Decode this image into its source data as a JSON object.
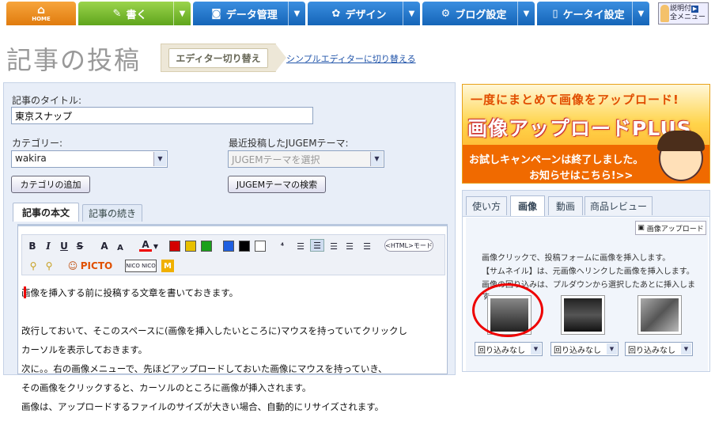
{
  "nav": {
    "home": "HOME",
    "write": "書く",
    "data": "データ管理",
    "design": "デザイン",
    "blog": "ブログ設定",
    "mobile": "ケータイ設定",
    "help_line1": "説明付",
    "help_line2": "全メニュー"
  },
  "page": {
    "title": "記事の投稿",
    "editor_switch": "エディター切り替え",
    "simple_editor_link": "シンプルエディターに切り替える"
  },
  "form": {
    "title_label": "記事のタイトル:",
    "title_value": "東京スナップ",
    "category_label": "カテゴリー:",
    "category_value": "wakira",
    "jugem_label": "最近投稿したJUGEMテーマ:",
    "jugem_placeholder": "JUGEMテーマを選択",
    "add_category": "カテゴリの追加",
    "search_jugem": "JUGEMテーマの検索"
  },
  "tabs": {
    "body": "記事の本文",
    "continued": "記事の続き"
  },
  "toolbar": {
    "bold": "B",
    "italic": "I",
    "underline": "U",
    "strike": "S",
    "size_up": "A",
    "size_down": "A",
    "font_color": "A",
    "html_mode": "<HTML>モード",
    "picto": "PICTO",
    "nico": "NICO NICO"
  },
  "colors": {
    "red": "#d40000",
    "yellow": "#e8c000",
    "green": "#1aa01a",
    "blue": "#1f5fe0",
    "black": "#000000",
    "white": "#ffffff"
  },
  "editor": {
    "line1": "画像を挿入する前に投稿する文章を書いておきます。",
    "line2": "改行しておいて、そこのスペースに(画像を挿入したいところに)マウスを持っていてクリックし",
    "line3": "カーソルを表示しておきます。",
    "line4": "次に。。右の画像メニューで、先ほどアップロードしておいた画像にマウスを持っていき、",
    "line5": "その画像をクリックすると、カーソルのところに画像が挿入されます。",
    "line6": "画像は、アップロードするファイルのサイズが大きい場合、自動的にリサイズされます。"
  },
  "banner": {
    "line1": "一度にまとめて画像をアップロード!",
    "line2": "画像アップロードPLUS",
    "line3": "お試しキャンペーンは終了しました。",
    "line4": "お知らせはこちら!>>"
  },
  "side": {
    "tabs": [
      "使い方",
      "画像",
      "動画",
      "商品レビュー"
    ],
    "upload_button": "画像アップロード",
    "info1": "画像クリックで、投稿フォームに画像を挿入します。",
    "info2": "【サムネイル】は、元画像へリンクした画像を挿入します。",
    "info3": "画像の回り込みは、プルダウンから選択したあとに挿入します。",
    "wrap_option": "回り込みなし"
  }
}
